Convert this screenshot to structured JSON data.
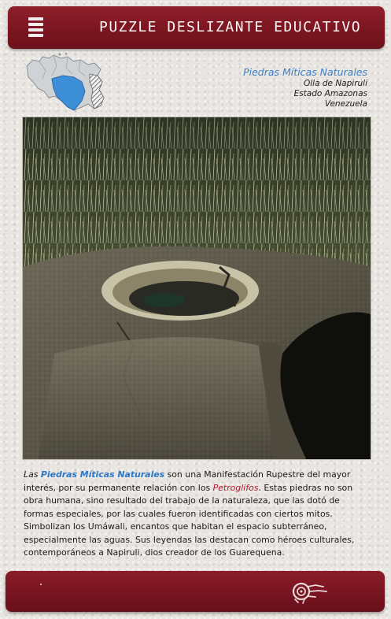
{
  "header": {
    "title": "PUZZLE DESLIZANTE EDUCATIVO",
    "menu_icon": "hamburger-menu-icon",
    "color": "#7d1722"
  },
  "map": {
    "icon": "venezuela-map-icon",
    "highlight_color": "#3d8fd8"
  },
  "location": {
    "title": "Piedras Míticas Naturales",
    "place": "Olla de Napiruli",
    "state": "Estado Amazonas",
    "country": "Venezuela"
  },
  "photo": {
    "subject": "piedras-miticas-photo"
  },
  "description": {
    "intro_word": "Las",
    "term": "Piedras Míticas Naturales",
    "part1": " son una Manifestación Rupestre del mayor interés, por su permanente relación con los ",
    "term2": "Petroglifos",
    "part2": ". Estas piedras no son obra humana, sino resultado del trabajo de la naturaleza, que las dotó de formas especiales, por las cuales fueron identificadas con ciertos mitos. Simbolizan los Umáwali, encantos que habitan el espacio subterráneo, especialmente las aguas. Sus leyendas las destacan como héroes culturales, contemporáneos a Napiruli, dios creador de los Guarequena."
  },
  "footer": {
    "logo_icon": "petroglyph-logo-icon",
    "color": "#7a1520"
  },
  "colors": {
    "accent_blue": "#2d78c6",
    "accent_red": "#b01e2f",
    "bar_red": "#7d1722"
  }
}
